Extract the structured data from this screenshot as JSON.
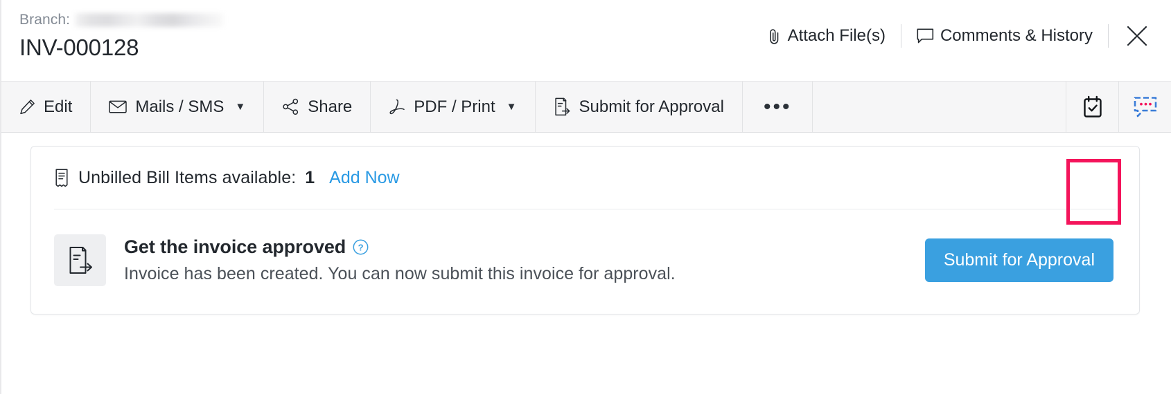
{
  "header": {
    "branch_label": "Branch:",
    "branch_value_redacted": "",
    "title": "INV-000128",
    "actions": [
      {
        "label": "Attach File(s)",
        "icon": "paperclip-icon"
      },
      {
        "label": "Comments & History",
        "icon": "comment-icon"
      }
    ],
    "close_label": "✕"
  },
  "toolbar": {
    "items": [
      {
        "label": "Edit",
        "icon": "pencil-icon",
        "caret": false
      },
      {
        "label": "Mails / SMS",
        "icon": "envelope-icon",
        "caret": true
      },
      {
        "label": "Share",
        "icon": "share-icon",
        "caret": false
      },
      {
        "label": "PDF / Print",
        "icon": "pdf-icon",
        "caret": true
      },
      {
        "label": "Submit for Approval",
        "icon": "document-arrow-icon",
        "caret": false
      }
    ],
    "more_label": "•••",
    "caret_glyph": "▼",
    "right_icons": [
      {
        "name": "clipboard-check-icon",
        "highlighted": true
      },
      {
        "name": "chat-bubble-icon",
        "highlighted": false
      }
    ]
  },
  "card": {
    "unbilled": {
      "icon": "receipt-icon",
      "text": "Unbilled Bill Items available:",
      "count": "1",
      "link_label": "Add Now"
    },
    "approval": {
      "icon": "document-arrow-icon",
      "title": "Get the invoice approved",
      "help_glyph": "?",
      "description": "Invoice has been created. You can now submit this invoice for approval.",
      "button_label": "Submit for Approval"
    }
  },
  "colors": {
    "highlight": "#f4145b",
    "link": "#2a9ae4",
    "primary_button": "#3aa0e0",
    "toolbar_bg": "#f6f6f7",
    "text": "#23282e",
    "muted_text": "#838a94",
    "chat_icon_blue": "#3b7dd8",
    "chat_icon_dots": "#f4145b"
  }
}
